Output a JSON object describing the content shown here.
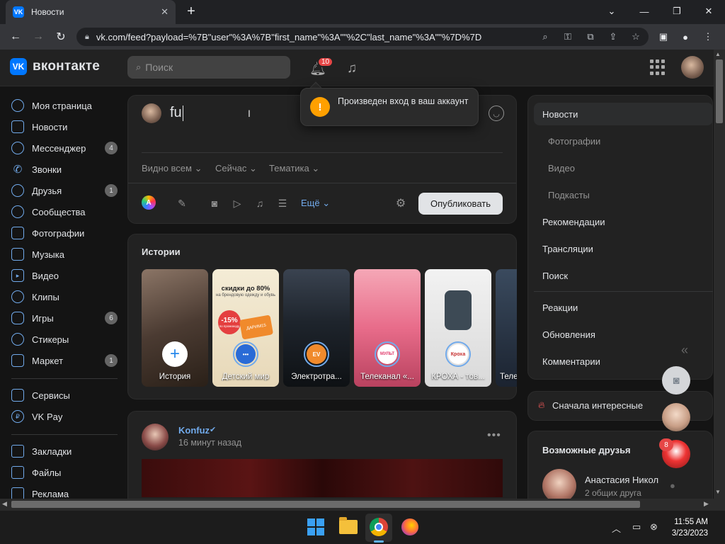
{
  "browser": {
    "tab_title": "Новости",
    "tab_favicon": "VK",
    "url": "vk.com/feed?payload=%7B\"user\"%3A%7B\"first_name\"%3A\"\"%2C\"last_name\"%3A\"\"%7D%7D"
  },
  "header": {
    "logo_mark": "VK",
    "logo_text": "вконтакте",
    "search_placeholder": "Поиск",
    "notifications_count": "10"
  },
  "leftnav": {
    "items": [
      {
        "label": "Моя страница",
        "icon": "user-circle-icon",
        "badge": ""
      },
      {
        "label": "Новости",
        "icon": "news-icon",
        "badge": ""
      },
      {
        "label": "Мессенджер",
        "icon": "message-icon",
        "badge": "4"
      },
      {
        "label": "Звонки",
        "icon": "phone-icon",
        "badge": ""
      },
      {
        "label": "Друзья",
        "icon": "friends-icon",
        "badge": "1"
      },
      {
        "label": "Сообщества",
        "icon": "communities-icon",
        "badge": ""
      },
      {
        "label": "Фотографии",
        "icon": "photo-icon",
        "badge": ""
      },
      {
        "label": "Музыка",
        "icon": "music-icon",
        "badge": ""
      },
      {
        "label": "Видео",
        "icon": "video-icon",
        "badge": ""
      },
      {
        "label": "Клипы",
        "icon": "clips-icon",
        "badge": ""
      },
      {
        "label": "Игры",
        "icon": "games-icon",
        "badge": "6"
      },
      {
        "label": "Стикеры",
        "icon": "sticker-icon",
        "badge": ""
      },
      {
        "label": "Маркет",
        "icon": "market-icon",
        "badge": "1"
      }
    ],
    "items2": [
      {
        "label": "Сервисы",
        "icon": "services-icon"
      },
      {
        "label": "VK Pay",
        "icon": "vkpay-icon"
      }
    ],
    "items3": [
      {
        "label": "Закладки",
        "icon": "bookmark-icon"
      },
      {
        "label": "Файлы",
        "icon": "file-icon"
      },
      {
        "label": "Реклама",
        "icon": "ads-icon"
      }
    ]
  },
  "composer": {
    "text": "fu",
    "visibility": "Видно всем",
    "time": "Сейчас",
    "topic": "Тематика",
    "more": "Ещё",
    "publish": "Опубликовать"
  },
  "toast": {
    "text": "Произведен вход в ваш аккаунт",
    "icon": "exclamation-icon"
  },
  "stories": {
    "title": "Истории",
    "items": [
      {
        "label": "История"
      },
      {
        "label": "Детский мир"
      },
      {
        "label": "Электротра..."
      },
      {
        "label": "Телеканал «..."
      },
      {
        "label": "КРОХА - тов..."
      },
      {
        "label": "Теле"
      }
    ],
    "card2_headline": "скидки до 80%",
    "card2_sub": "на брендовую одежду и обувь",
    "card2_tag": "-15%",
    "card2_tag_sub": "по промокоду",
    "card2_code": "ДАРИМ15",
    "card4_mark": "МУЛЬТ",
    "card5_mark": "Кроха"
  },
  "post": {
    "author": "Konfuz",
    "time": "16 минут назад"
  },
  "rightmenu": {
    "news": "Новости",
    "photos": "Фотографии",
    "video": "Видео",
    "podcasts": "Подкасты",
    "recommendations": "Рекомендации",
    "broadcasts": "Трансляции",
    "search": "Поиск",
    "reactions": "Реакции",
    "updates": "Обновления",
    "comments": "Комментарии"
  },
  "sort": {
    "label": "Сначала интересные"
  },
  "friends": {
    "title": "Возможные друзья",
    "name": "Анастасия Никол",
    "mutual": "2 общих друга"
  },
  "chat": {
    "badge": "8"
  },
  "taskbar": {
    "time": "11:55 AM",
    "date": "3/23/2023"
  },
  "colors": {
    "accent": "#71aaeb",
    "brand": "#0077ff",
    "badge": "#e64646",
    "toast_icon": "#ffa000",
    "background": "#141414",
    "card": "#222222"
  }
}
